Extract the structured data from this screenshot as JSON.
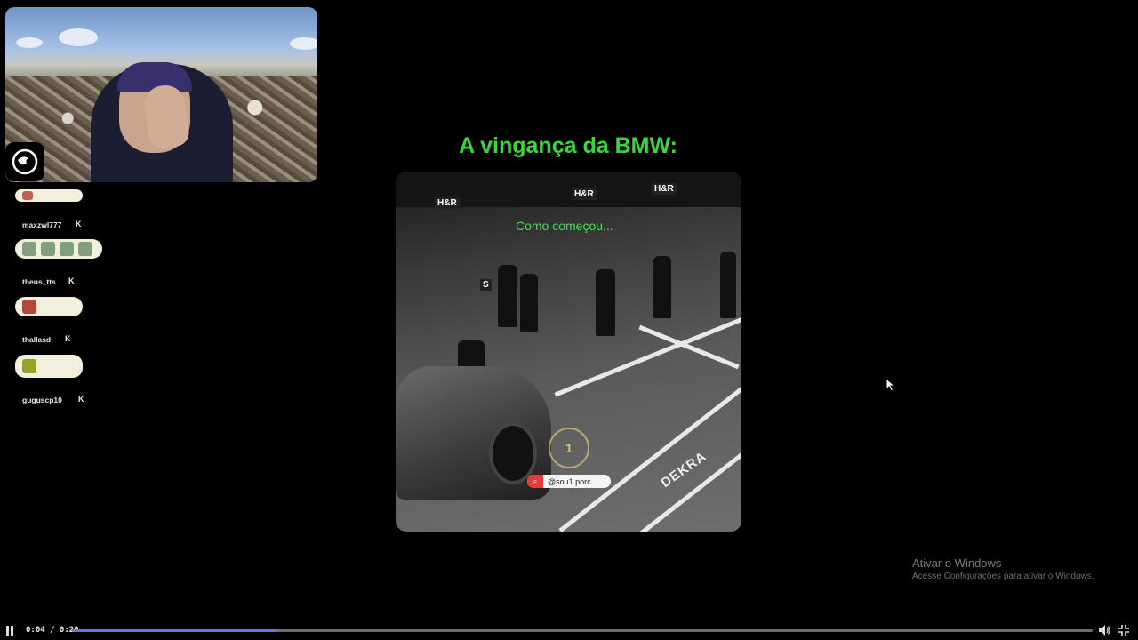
{
  "video": {
    "title": "A vingança da BMW:",
    "caption": "Como começou...",
    "handle": "@sou1.porc",
    "dekra_text": "DEKRA",
    "signs": [
      "H&R",
      "H&R",
      "H&R",
      "S"
    ],
    "watermark_glyph": "1"
  },
  "chat": {
    "messages": [
      {
        "user": "maxzwl777",
        "emote_count": 4
      },
      {
        "user": "theus_tts",
        "emote_count": 1
      },
      {
        "user": "thallasd",
        "emote_count": 1
      },
      {
        "user": "guguscp10",
        "emote_count": 0
      }
    ]
  },
  "player": {
    "time": "0:04 / 0:20",
    "progress": 0.2
  },
  "windows_watermark": {
    "title": "Ativar o Windows",
    "subtitle": "Acesse Configurações para ativar o Windows."
  },
  "icons": {
    "logo": "channel-logo-icon",
    "kick": "kick-icon",
    "pause": "pause-icon",
    "volume": "volume-icon",
    "fullscreen": "exit-fullscreen-icon",
    "cursor": "mouse-cursor-icon"
  },
  "colors": {
    "title_green": "#3bd63b",
    "caption_green": "#44e04a",
    "progress": "#6f6fe8",
    "chat_pill": "#f2f0dd"
  }
}
